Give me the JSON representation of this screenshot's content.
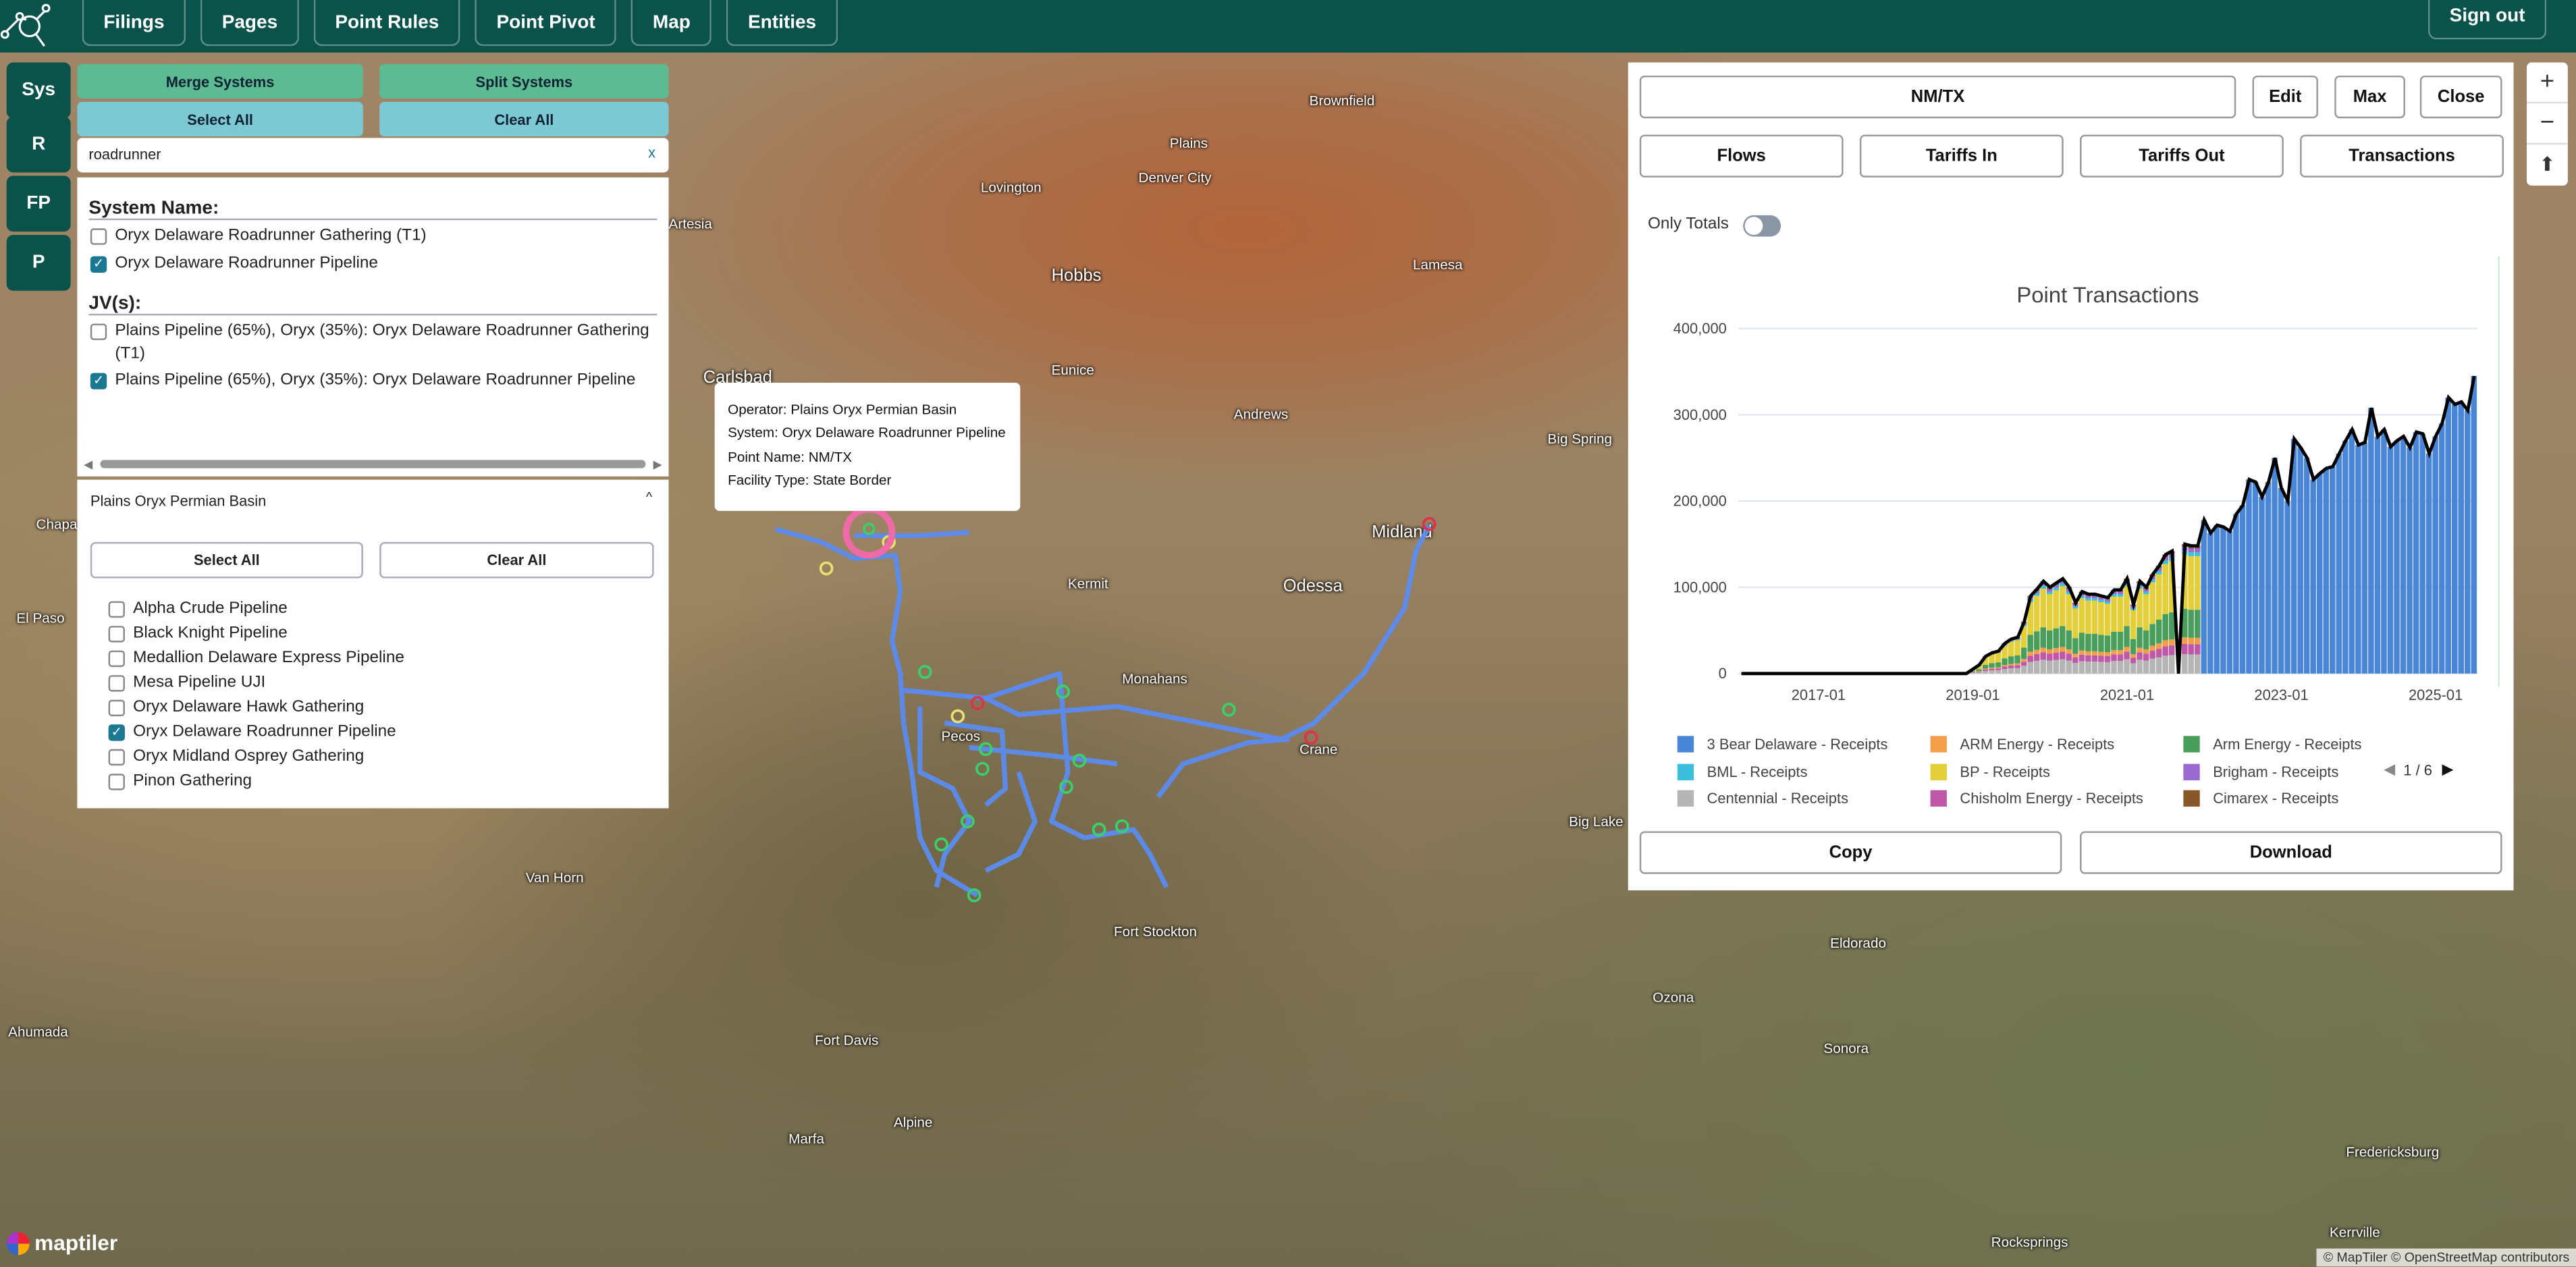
{
  "nav": {
    "items": [
      "Filings",
      "Pages",
      "Point Rules",
      "Point Pivot",
      "Map",
      "Entities"
    ],
    "sign_out": "Sign out"
  },
  "side_buttons": [
    "Sys",
    "R",
    "FP",
    "P"
  ],
  "left_panel": {
    "merge": "Merge Systems",
    "split": "Split Systems",
    "select_all": "Select All",
    "clear_all": "Clear All",
    "search": {
      "value": "roadrunner",
      "clear": "x"
    },
    "system_name_heading": "System Name:",
    "systems": [
      {
        "label": "Oryx Delaware Roadrunner Gathering (T1)",
        "checked": false
      },
      {
        "label": "Oryx Delaware Roadrunner Pipeline",
        "checked": true
      }
    ],
    "jv_heading": "JV(s):",
    "jvs": [
      {
        "label": "Plains Pipeline (65%), Oryx (35%): Oryx Delaware Roadrunner Gathering (T1)",
        "checked": false
      },
      {
        "label": "Plains Pipeline (65%), Oryx (35%): Oryx Delaware Roadrunner Pipeline",
        "checked": true
      }
    ],
    "operator": "Plains Oryx Permian Basin",
    "op_select_all": "Select All",
    "op_clear_all": "Clear All",
    "pipelines": [
      {
        "label": "Alpha Crude Pipeline",
        "checked": false
      },
      {
        "label": "Black Knight Pipeline",
        "checked": false
      },
      {
        "label": "Medallion Delaware Express Pipeline",
        "checked": false
      },
      {
        "label": "Mesa Pipeline UJI",
        "checked": false
      },
      {
        "label": "Oryx Delaware Hawk Gathering",
        "checked": false
      },
      {
        "label": "Oryx Delaware Roadrunner Pipeline",
        "checked": true
      },
      {
        "label": "Oryx Midland Osprey Gathering",
        "checked": false
      },
      {
        "label": "Pinon Gathering",
        "checked": false
      }
    ]
  },
  "tooltip": {
    "operator": "Operator: Plains Oryx Permian Basin",
    "system": "System: Oryx Delaware Roadrunner Pipeline",
    "point": "Point Name: NM/TX",
    "facility": "Facility Type: State Border"
  },
  "right_panel": {
    "point": "NM/TX",
    "edit": "Edit",
    "max": "Max",
    "close": "Close",
    "tabs": [
      "Flows",
      "Tariffs In",
      "Tariffs Out",
      "Transactions"
    ],
    "only_totals": "Only Totals",
    "only_totals_on": false,
    "copy": "Copy",
    "download": "Download",
    "legend_page": "1 / 6"
  },
  "chart_data": {
    "type": "bar",
    "title": "Point Transactions",
    "start": "2016-01",
    "xticks": [
      "2017-01",
      "2019-01",
      "2021-01",
      "2023-01",
      "2025-01"
    ],
    "ylim": [
      0,
      400000
    ],
    "yticks": [
      "0",
      "100,000",
      "200,000",
      "300,000",
      "400,000"
    ],
    "totals_k": [
      0,
      0,
      0,
      0,
      0,
      0,
      0,
      0,
      0,
      0,
      0,
      0,
      0,
      0,
      0,
      0,
      0,
      0,
      0,
      0,
      0,
      0,
      0,
      0,
      0,
      0,
      0,
      0,
      0,
      0,
      0,
      0,
      0,
      0,
      0,
      0,
      5,
      10,
      20,
      24,
      26,
      35,
      40,
      42,
      60,
      90,
      98,
      107,
      100,
      105,
      110,
      100,
      82,
      95,
      92,
      92,
      90,
      88,
      97,
      97,
      110,
      80,
      107,
      100,
      115,
      125,
      138,
      142,
      0,
      150,
      148,
      148,
      178,
      163,
      172,
      170,
      165,
      185,
      195,
      225,
      222,
      205,
      222,
      250,
      215,
      200,
      272,
      262,
      250,
      225,
      232,
      238,
      240,
      255,
      270,
      283,
      265,
      268,
      308,
      275,
      283,
      263,
      270,
      275,
      262,
      280,
      278,
      255,
      275,
      290,
      320,
      312,
      315,
      305,
      345
    ],
    "blue_from_index": 72,
    "early_mix": [
      {
        "c": "#b5b5b5",
        "f": 0.15
      },
      {
        "c": "#c058a8",
        "f": 0.08
      },
      {
        "c": "#f59e4a",
        "f": 0.05
      },
      {
        "c": "#4a9e5c",
        "f": 0.22
      },
      {
        "c": "#e2cf3a",
        "f": 0.42
      },
      {
        "c": "#3bbfdc",
        "f": 0.03
      },
      {
        "c": "#9a6ad0",
        "f": 0.03
      },
      {
        "c": "#86582a",
        "f": 0.02
      }
    ],
    "legend": [
      {
        "label": "3 Bear Delaware - Receipts",
        "color": "#4a86d8"
      },
      {
        "label": "ARM Energy - Receipts",
        "color": "#f59e4a"
      },
      {
        "label": "Arm Energy - Receipts",
        "color": "#4a9e5c"
      },
      {
        "label": "BML - Receipts",
        "color": "#3bbfdc"
      },
      {
        "label": "BP - Receipts",
        "color": "#e2cf3a"
      },
      {
        "label": "Brigham - Receipts",
        "color": "#9a6ad0"
      },
      {
        "label": "Centennial - Receipts",
        "color": "#b5b5b5"
      },
      {
        "label": "Chisholm Energy - Receipts",
        "color": "#c058a8"
      },
      {
        "label": "Cimarex - Receipts",
        "color": "#86582a"
      }
    ]
  },
  "map": {
    "cities": [
      "Plains",
      "Brownfield",
      "Lovington",
      "Denver City",
      "Artesia",
      "Hobbs",
      "Lamesa",
      "Carlsbad",
      "Eunice",
      "Andrews",
      "Big Spring",
      "Chapa",
      "Midland",
      "Odessa",
      "Kermit",
      "El Paso",
      "Monahans",
      "Pecos",
      "Crane",
      "Big Lake",
      "Van Horn",
      "Fort Stockton",
      "Eldorado",
      "Ozona",
      "Ahumada",
      "Fort Davis",
      "Sonora",
      "Marfa",
      "Alpine",
      "Fredericksburg",
      "Rocksprings",
      "Kerrville"
    ],
    "logo": "maptiler",
    "attribution": "© MapTiler © OpenStreetMap contributors",
    "zoom_in": "+",
    "zoom_out": "−"
  }
}
